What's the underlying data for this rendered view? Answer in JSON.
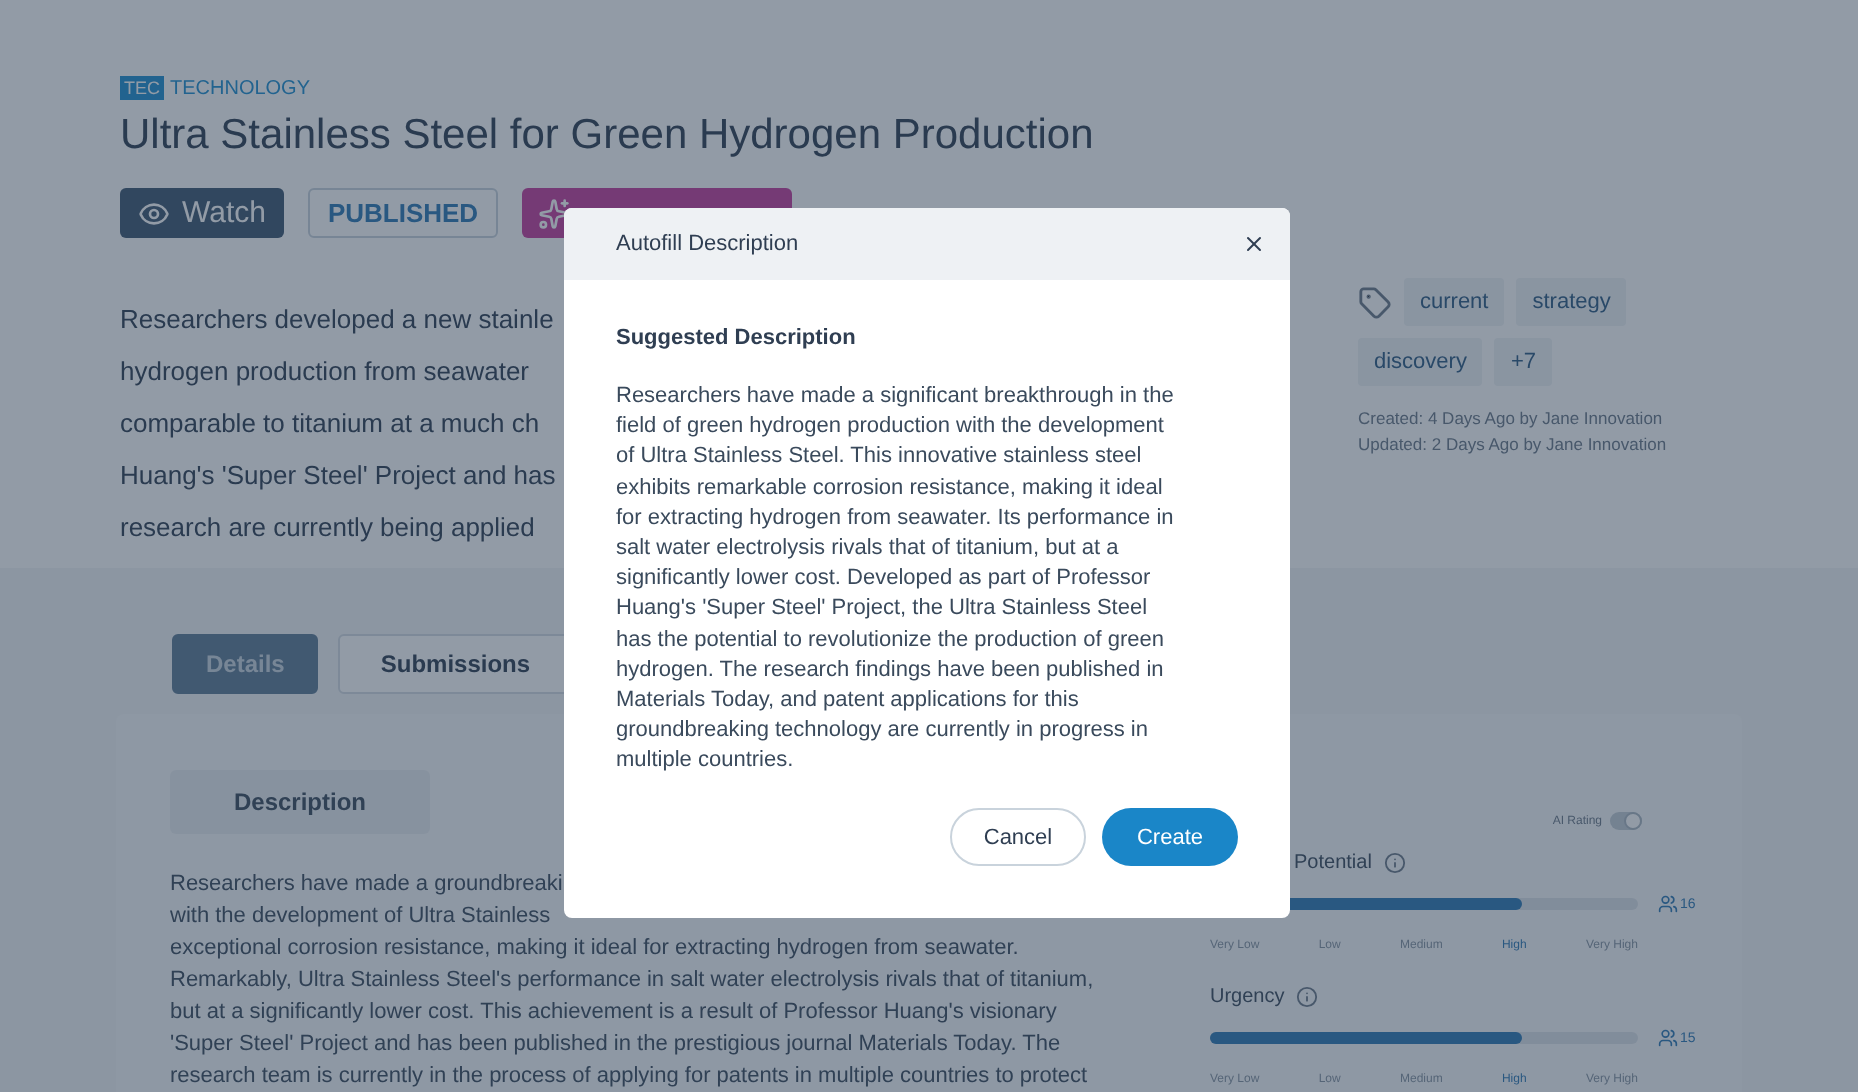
{
  "category": {
    "code": "TEC",
    "label": "TECHNOLOGY"
  },
  "title": "Ultra Stainless Steel for Green Hydrogen Production",
  "actions": {
    "watch": "Watch",
    "status": "PUBLISHED"
  },
  "summary_lines": [
    "Researchers developed a new stainle",
    "hydrogen production from seawater",
    "comparable to titanium at a much ch",
    "Huang's 'Super Steel' Project and has",
    "research are currently being applied"
  ],
  "tags": [
    "current",
    "strategy",
    "discovery",
    "+7"
  ],
  "meta": [
    "Created: 4 Days Ago by Jane Innovation",
    "Updated: 2 Days Ago by Jane Innovation"
  ],
  "tabs": [
    {
      "label": "Details",
      "selected": true
    },
    {
      "label": "Submissions",
      "selected": false
    }
  ],
  "description": {
    "heading": "Description",
    "lines": [
      "Researchers have made a groundbreaki",
      "with the development of Ultra Stainless",
      "exceptional corrosion resistance, making it ideal for extracting hydrogen from seawater.",
      "Remarkably, Ultra Stainless Steel's performance in salt water electrolysis rivals that of titanium,",
      "but at a significantly lower cost. This achievement is a result of Professor Huang's visionary",
      "'Super Steel' Project and has been published in the prestigious journal Materials Today. The",
      "research team is currently in the process of applying for patents in multiple countries to protect"
    ]
  },
  "ratings": {
    "ai_rating": {
      "label": "AI Rating",
      "on": true
    },
    "items": [
      {
        "label": "Potential",
        "level": 0.73,
        "count": "16",
        "scale": [
          {
            "label": "Very Low",
            "selected": false
          },
          {
            "label": "Low",
            "selected": false
          },
          {
            "label": "Medium",
            "selected": false
          },
          {
            "label": "High",
            "selected": true
          },
          {
            "label": "Very High",
            "selected": false
          }
        ]
      },
      {
        "label": "Urgency",
        "level": 0.73,
        "count": "15",
        "scale": [
          {
            "label": "Very Low",
            "selected": false
          },
          {
            "label": "Low",
            "selected": false
          },
          {
            "label": "Medium",
            "selected": false
          },
          {
            "label": "High",
            "selected": true
          },
          {
            "label": "Very High",
            "selected": false
          }
        ]
      }
    ]
  },
  "modal": {
    "title": "Autofill Description",
    "heading": "Suggested Description",
    "text": "Researchers have made a significant breakthrough in the field of green hydrogen production with the development of Ultra Stainless Steel. This innovative stainless steel exhibits remarkable corrosion resistance, making it ideal for extracting hydrogen from seawater. Its performance in salt water electrolysis rivals that of titanium, but at a significantly lower cost. Developed as part of Professor Huang's 'Super Steel' Project, the Ultra Stainless Steel has the potential to revolutionize the production of green hydrogen. The research findings have been published in Materials Today, and patent applications for this groundbreaking technology are currently in progress in multiple countries.",
    "buttons": [
      {
        "label": "Cancel",
        "kind": "secondary"
      },
      {
        "label": "Create",
        "kind": "primary"
      }
    ]
  }
}
